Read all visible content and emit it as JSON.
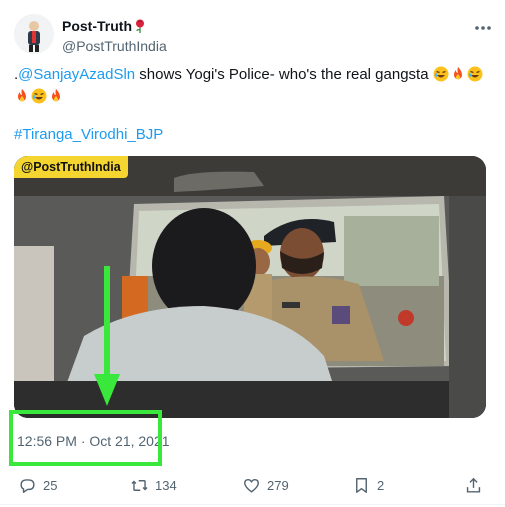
{
  "author": {
    "name": "Post-Truth",
    "handle": "@PostTruthIndia",
    "name_emoji": "rose-icon"
  },
  "tweet": {
    "text_prefix": ".",
    "mention": "@SanjayAzadSln",
    "text_body": " shows Yogi's Police- who's the real gangsta ",
    "emojis_line1": [
      "rofl-emoji",
      "fire-emoji",
      "rofl-emoji"
    ],
    "emojis_line2": [
      "fire-emoji",
      "rofl-emoji",
      "fire-emoji"
    ],
    "hashtag": "#Tiranga_Virodhi_BJP"
  },
  "media": {
    "watermark": "@PostTruthIndia"
  },
  "timestamp": "12:56 PM · Oct 21, 2021",
  "actions": {
    "replies": "25",
    "retweets": "134",
    "likes": "279",
    "bookmarks": "2"
  },
  "colors": {
    "accent": "#1d9bf0",
    "highlight": "#39e83a",
    "watermark_bg": "#f5d631",
    "muted_text": "#536471"
  }
}
